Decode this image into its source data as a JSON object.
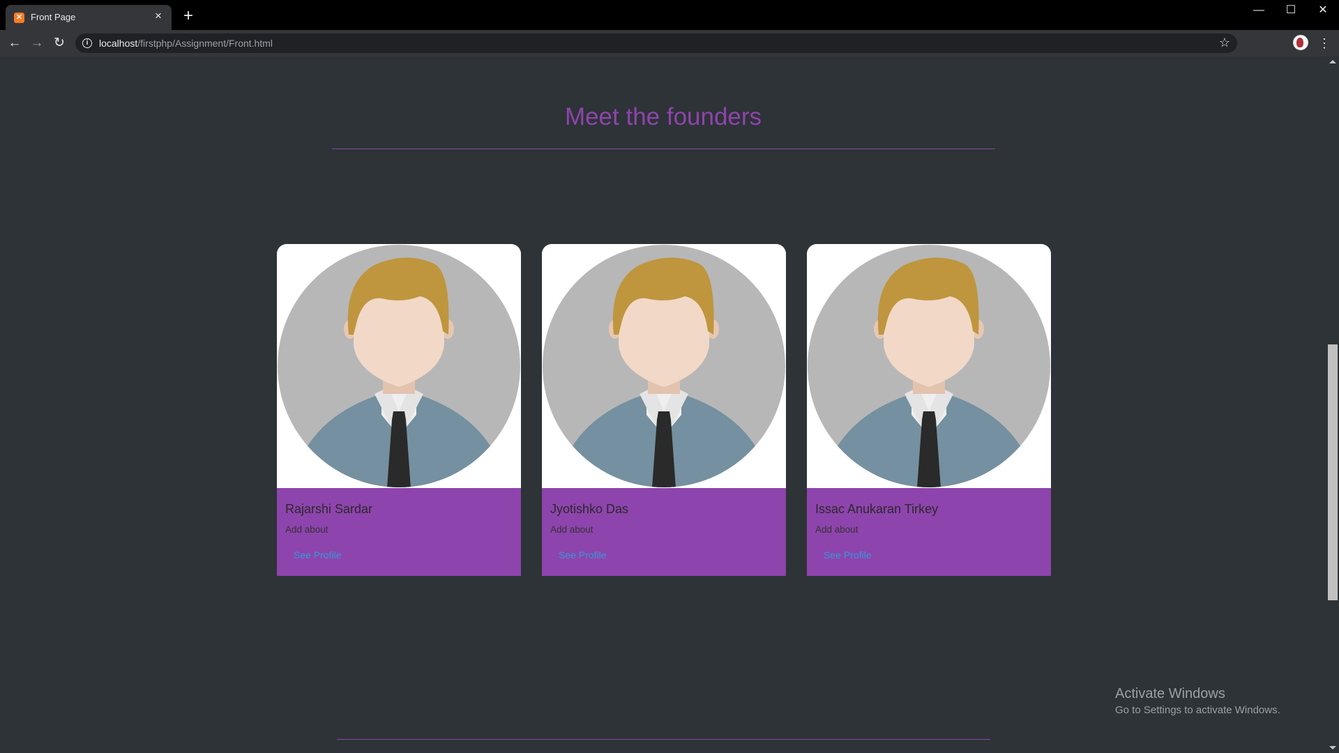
{
  "browser": {
    "tab_title": "Front Page",
    "tab_favicon": "xampp-icon",
    "url_host": "localhost",
    "url_path": "/firstphp/Assignment/Front.html",
    "window_controls": [
      "minimize",
      "maximize",
      "close"
    ]
  },
  "page": {
    "title": "Meet the founders",
    "accent_color": "#8e44ad",
    "link_color": "#3498db",
    "background_color": "#2d3336",
    "founders": [
      {
        "name": "Rajarshi Sardar",
        "about": "Add about",
        "link": "See Profile"
      },
      {
        "name": "Jyotishko Das",
        "about": "Add about",
        "link": "See Profile"
      },
      {
        "name": "Issac Anukaran Tirkey",
        "about": "Add about",
        "link": "See Profile"
      }
    ]
  },
  "watermark": {
    "title": "Activate Windows",
    "subtitle": "Go to Settings to activate Windows."
  }
}
